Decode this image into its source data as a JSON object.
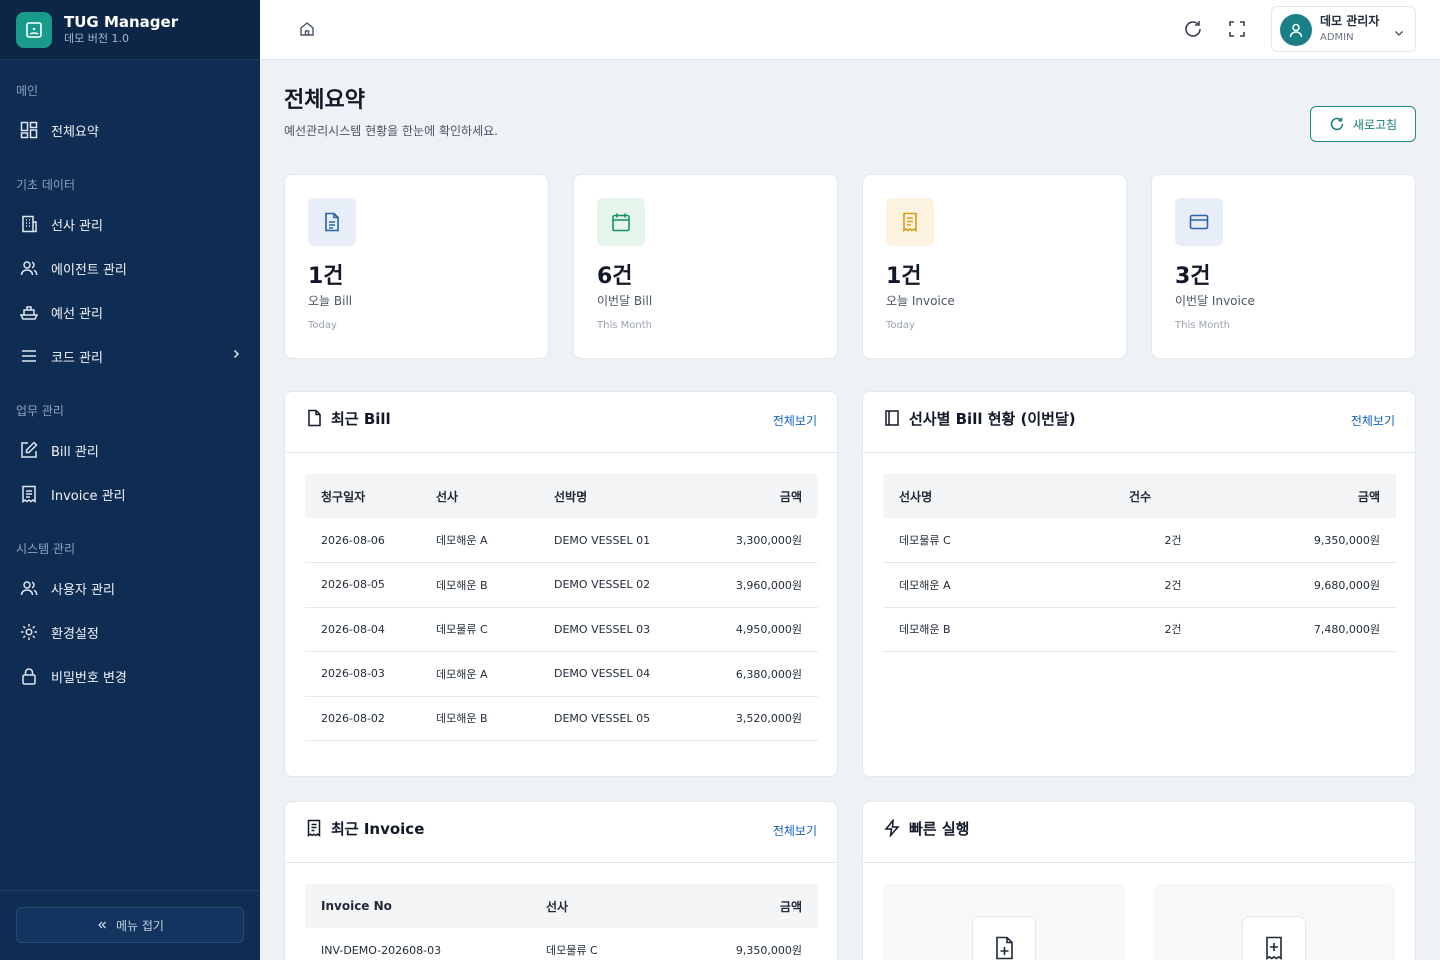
{
  "brand": {
    "title": "TUG Manager",
    "subtitle": "데모 버전 1.0",
    "color": "#1a9a8a"
  },
  "sidebar": {
    "sections": [
      {
        "label": "메인"
      },
      {
        "label": "기초 데이터"
      },
      {
        "label": "업무 관리"
      },
      {
        "label": "시스템 관리"
      }
    ],
    "items": [
      {
        "label": "전체요약",
        "icon": "dashboard-icon"
      },
      {
        "label": "선사 관리",
        "icon": "building-icon"
      },
      {
        "label": "에이전트 관리",
        "icon": "users-icon"
      },
      {
        "label": "예선 관리",
        "icon": "ship-icon"
      },
      {
        "label": "코드 관리",
        "icon": "list-icon"
      },
      {
        "label": "Bill 관리",
        "icon": "edit-icon"
      },
      {
        "label": "Invoice 관리",
        "icon": "receipt-icon"
      },
      {
        "label": "사용자 관리",
        "icon": "users-icon"
      },
      {
        "label": "환경설정",
        "icon": "gear-icon"
      },
      {
        "label": "비밀번호 변경",
        "icon": "lock-icon"
      }
    ],
    "collapse_label": "메뉴 접기"
  },
  "topbar": {
    "user_name": "데모 관리자",
    "user_role": "ADMIN"
  },
  "header": {
    "title": "전체요약",
    "subtitle": "예선관리시스템 현황을 한눈에 확인하세요.",
    "refresh_label": "새로고침"
  },
  "stats": [
    {
      "value": "1건",
      "label": "오늘 Bill",
      "period": "Today",
      "color": "#2563a8"
    },
    {
      "value": "6건",
      "label": "이번달 Bill",
      "period": "This Month",
      "color": "#17945a"
    },
    {
      "value": "1건",
      "label": "오늘 Invoice",
      "period": "Today",
      "color": "#d99b1a"
    },
    {
      "value": "3건",
      "label": "이번달 Invoice",
      "period": "This Month",
      "color": "#2f5fb0"
    }
  ],
  "recent_bill": {
    "title": "최근 Bill",
    "link": "전체보기",
    "columns": [
      "청구일자",
      "선사",
      "선박명",
      "금액"
    ],
    "rows": [
      [
        "2026-08-06",
        "데모해운 A",
        "DEMO VESSEL 01",
        "3,300,000원"
      ],
      [
        "2026-08-05",
        "데모해운 B",
        "DEMO VESSEL 02",
        "3,960,000원"
      ],
      [
        "2026-08-04",
        "데모물류 C",
        "DEMO VESSEL 03",
        "4,950,000원"
      ],
      [
        "2026-08-03",
        "데모해운 A",
        "DEMO VESSEL 04",
        "6,380,000원"
      ],
      [
        "2026-08-02",
        "데모해운 B",
        "DEMO VESSEL 05",
        "3,520,000원"
      ]
    ]
  },
  "company_bill": {
    "title": "선사별 Bill 현황 (이번달)",
    "link": "전체보기",
    "columns": [
      "선사명",
      "건수",
      "금액"
    ],
    "rows": [
      [
        "데모물류 C",
        "2건",
        "9,350,000원"
      ],
      [
        "데모해운 A",
        "2건",
        "9,680,000원"
      ],
      [
        "데모해운 B",
        "2건",
        "7,480,000원"
      ]
    ]
  },
  "recent_invoice": {
    "title": "최근 Invoice",
    "link": "전체보기",
    "columns": [
      "Invoice No",
      "선사",
      "금액"
    ],
    "rows": [
      [
        "INV-DEMO-202608-03",
        "데모물류 C",
        "9,350,000원"
      ]
    ]
  },
  "quick": {
    "title": "빠른 실행"
  }
}
